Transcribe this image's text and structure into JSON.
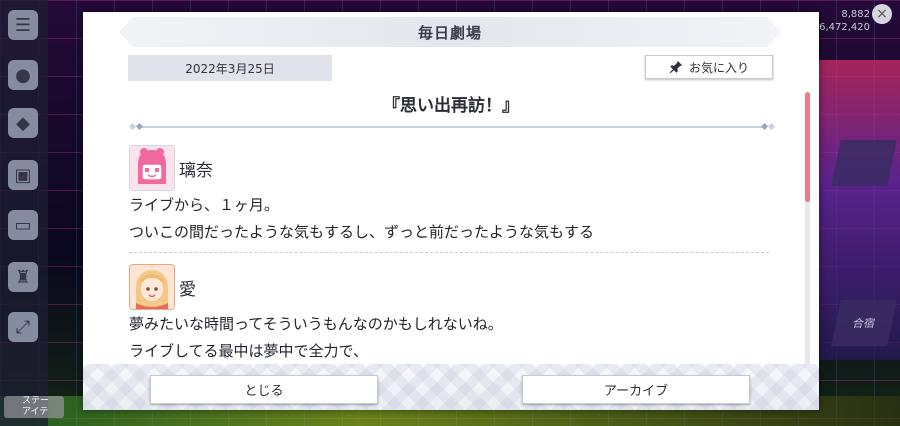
{
  "dialog": {
    "title": "毎日劇場",
    "date": "2022年3月25日",
    "favorite_label": "お気に入り",
    "episode_title": "『思い出再訪！』"
  },
  "entries": [
    {
      "speaker": "璃奈",
      "lines": [
        "ライブから、１ヶ月。",
        "ついこの間だったような気もするし、ずっと前だったような気もする"
      ]
    },
    {
      "speaker": "愛",
      "lines": [
        "夢みたいな時間ってそういうもんなのかもしれないね。",
        "ライブしてる最中は夢中で全力で、"
      ]
    }
  ],
  "footer": {
    "close_label": "とじる",
    "archive_label": "アーカイブ"
  },
  "background": {
    "stats": [
      "8,882",
      "6,472,420"
    ],
    "tile_1": "合宿",
    "chip": "ステー\nアイテ"
  },
  "colors": {
    "accent_scroll": "#f07a8c",
    "dialog_bg": "#ffffff",
    "header_bg": "#e4e6ee"
  }
}
